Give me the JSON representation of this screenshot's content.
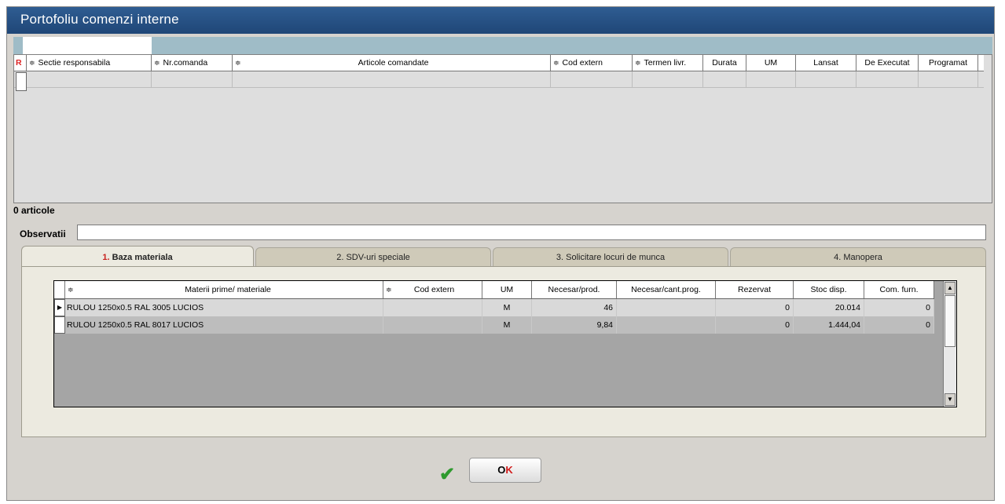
{
  "window": {
    "title": "Portofoliu comenzi interne"
  },
  "top_grid": {
    "flag": "R",
    "sort_glyph": "≑",
    "headers": [
      "Sectie responsabila",
      "Nr.comanda",
      "",
      "Articole comandate",
      "Cod extern",
      "Termen livr.",
      "Durata",
      "UM",
      "Lansat",
      "De Executat",
      "Programat"
    ]
  },
  "summary": {
    "count_text": "0 articole"
  },
  "observatii": {
    "label": "Observatii",
    "value": ""
  },
  "tabs": [
    {
      "num": "1.",
      "label": "Baza materiala"
    },
    {
      "num": "2.",
      "label": "SDV-uri speciale"
    },
    {
      "num": "3.",
      "label": "Solicitare locuri de munca"
    },
    {
      "num": "4.",
      "label": "Manopera"
    }
  ],
  "materials_grid": {
    "sort_glyph": "≑",
    "headers": [
      "Materii prime/ materiale",
      "Cod extern",
      "UM",
      "Necesar/prod.",
      "Necesar/cant.prog.",
      "Rezervat",
      "Stoc disp.",
      "Com. furn."
    ],
    "rows": [
      {
        "name": "RULOU 1250x0.5 RAL 3005 LUCIOS",
        "cod_extern": "",
        "um": "M",
        "necesar_prod": "46",
        "necesar_cant": "",
        "rezervat": "0",
        "stoc": "20.014",
        "com": "0"
      },
      {
        "name": "RULOU 1250x0.5 RAL 8017 LUCIOS",
        "cod_extern": "",
        "um": "M",
        "necesar_prod": "9,84",
        "necesar_cant": "",
        "rezervat": "0",
        "stoc": "1.444,04",
        "com": "0"
      }
    ]
  },
  "footer": {
    "ok_o": "O",
    "ok_k": "K",
    "check_icon": "✔"
  },
  "colors": {
    "titlebar": "#1f4677",
    "accent": "#c8201d"
  }
}
